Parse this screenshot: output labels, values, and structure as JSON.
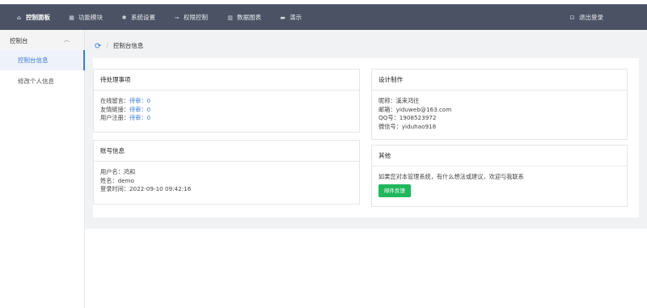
{
  "topbar": {
    "items": [
      {
        "label": "控制面板",
        "icon": "home-icon"
      },
      {
        "label": "功能模块",
        "icon": "grid-icon"
      },
      {
        "label": "系统设置",
        "icon": "gear-icon"
      },
      {
        "label": "权限控制",
        "icon": "key-icon"
      },
      {
        "label": "数据图表",
        "icon": "bar-chart-icon"
      },
      {
        "label": "演示",
        "icon": "folder-icon"
      }
    ],
    "logout": "退出登录"
  },
  "sidebar": {
    "section": "控制台",
    "items": [
      "控制台信息",
      "修改个人信息"
    ]
  },
  "breadcrumb": {
    "current": "控制台信息"
  },
  "pending": {
    "title": "待处理事项",
    "rows": [
      {
        "label": "在线留言：",
        "value": "待审：0"
      },
      {
        "label": "友情链接：",
        "value": "待审：0"
      },
      {
        "label": "用户注册：",
        "value": "待审：0"
      }
    ]
  },
  "account": {
    "title": "账号信息",
    "rows": [
      "用户名：鸿和",
      "姓名：demo",
      "登录时间：2022-09-10 09:42:16"
    ]
  },
  "design": {
    "title": "设计制作",
    "rows": [
      "昵称：溪来鸿往",
      "邮箱：yiduweb@163.com",
      "QQ号：1908523972",
      "微信号：yiduhao918"
    ]
  },
  "other": {
    "title": "其他",
    "text": "如果您对本管理系统，有什么想法或建议，欢迎与我联系",
    "button": "邮件反馈"
  },
  "colors": {
    "topbar": "#4a5264",
    "accent": "#3b7bd6",
    "button": "#1fb85c"
  }
}
